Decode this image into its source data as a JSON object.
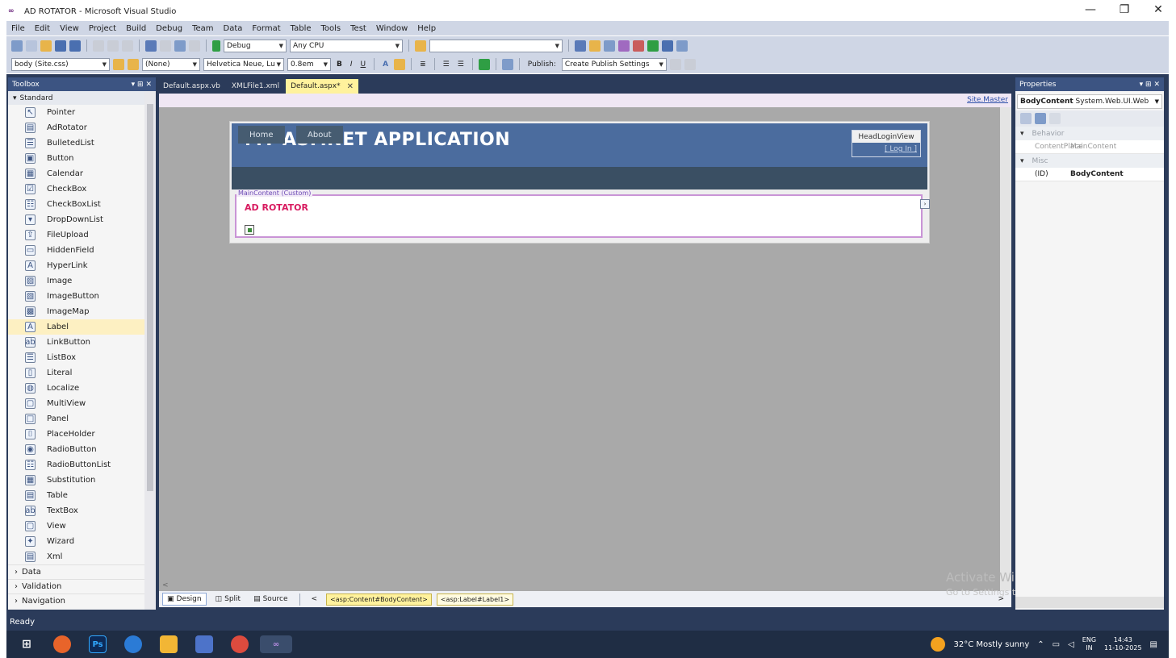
{
  "window": {
    "title": "AD ROTATOR - Microsoft Visual Studio",
    "min": "—",
    "max": "❐",
    "close": "✕"
  },
  "menu": [
    "File",
    "Edit",
    "View",
    "Project",
    "Build",
    "Debug",
    "Team",
    "Data",
    "Format",
    "Table",
    "Tools",
    "Test",
    "Window",
    "Help"
  ],
  "toolbar1": {
    "config": "Debug",
    "platform": "Any CPU"
  },
  "toolbar2": {
    "target_rule": "body (Site.css)",
    "style": "(None)",
    "font": "Helvetica Neue, Lu",
    "size": "0.8em",
    "publish_label": "Publish:",
    "publish_settings": "Create Publish Settings"
  },
  "toolbox": {
    "title": "Toolbox",
    "header_icons": "▾ ⊞ ✕",
    "section": "Standard",
    "items": [
      {
        "label": "Pointer",
        "icon": "↖"
      },
      {
        "label": "AdRotator",
        "icon": "▤"
      },
      {
        "label": "BulletedList",
        "icon": "☰"
      },
      {
        "label": "Button",
        "icon": "▣"
      },
      {
        "label": "Calendar",
        "icon": "▦"
      },
      {
        "label": "CheckBox",
        "icon": "☑"
      },
      {
        "label": "CheckBoxList",
        "icon": "☷"
      },
      {
        "label": "DropDownList",
        "icon": "▾"
      },
      {
        "label": "FileUpload",
        "icon": "⇪"
      },
      {
        "label": "HiddenField",
        "icon": "▭"
      },
      {
        "label": "HyperLink",
        "icon": "A"
      },
      {
        "label": "Image",
        "icon": "▨"
      },
      {
        "label": "ImageButton",
        "icon": "▧"
      },
      {
        "label": "ImageMap",
        "icon": "▩"
      },
      {
        "label": "Label",
        "icon": "A"
      },
      {
        "label": "LinkButton",
        "icon": "ab"
      },
      {
        "label": "ListBox",
        "icon": "☰"
      },
      {
        "label": "Literal",
        "icon": "▯"
      },
      {
        "label": "Localize",
        "icon": "◍"
      },
      {
        "label": "MultiView",
        "icon": "▢"
      },
      {
        "label": "Panel",
        "icon": "□"
      },
      {
        "label": "PlaceHolder",
        "icon": "⌷"
      },
      {
        "label": "RadioButton",
        "icon": "◉"
      },
      {
        "label": "RadioButtonList",
        "icon": "☷"
      },
      {
        "label": "Substitution",
        "icon": "▦"
      },
      {
        "label": "Table",
        "icon": "▤"
      },
      {
        "label": "TextBox",
        "icon": "ab"
      },
      {
        "label": "View",
        "icon": "▢"
      },
      {
        "label": "Wizard",
        "icon": "✦"
      },
      {
        "label": "Xml",
        "icon": "▤"
      }
    ],
    "selected_index": 14,
    "groups": [
      "Data",
      "Validation",
      "Navigation"
    ]
  },
  "tabs": [
    {
      "label": "Default.aspx.vb",
      "active": false
    },
    {
      "label": "XMLFile1.xml",
      "active": false
    },
    {
      "label": "Default.aspx*",
      "active": true
    }
  ],
  "tab_close": "✕",
  "designer": {
    "site_master": "Site.Master",
    "app_title": "MY ASP.NET APPLICATION",
    "login_view": "HeadLoginView",
    "login_link": "[ Log In ]",
    "nav": [
      "Home",
      "About"
    ],
    "content_tag": "MainContent (Custom)",
    "ad_label": "AD ROTATOR",
    "smart_tag": "›",
    "hscroll": "<"
  },
  "viewbar": {
    "design": "Design",
    "split": "Split",
    "source": "Source",
    "crumb_prev": "<",
    "crumb1": "<asp:Content#BodyContent>",
    "crumb2": "<asp:Label#Label1>",
    "crumb_next": ">"
  },
  "watermark": {
    "line1": "Activate Windows",
    "line2": "Go to Settings to activate Windows."
  },
  "properties": {
    "title": "Properties",
    "header_icons": "▾ ⊞ ✕",
    "object_name": "BodyContent",
    "object_type": "System.Web.UI.Web",
    "categories": [
      {
        "name": "Behavior",
        "rows": [
          {
            "key": "ContentPlace",
            "value": "MainContent",
            "bold": false
          }
        ]
      },
      {
        "name": "Misc",
        "rows": [
          {
            "key": "(ID)",
            "value": "BodyContent",
            "bold": true
          }
        ]
      }
    ]
  },
  "status": "Ready",
  "taskbar": {
    "weather": "32°C  Mostly sunny",
    "lang_top": "ENG",
    "lang_bottom": "IN",
    "time": "14:43",
    "date": "11-10-2025"
  },
  "colors": {
    "accent": "#3c5482",
    "banner": "#4b6c9e",
    "selected": "#fdf0c2",
    "ad_label": "#d81b60"
  }
}
